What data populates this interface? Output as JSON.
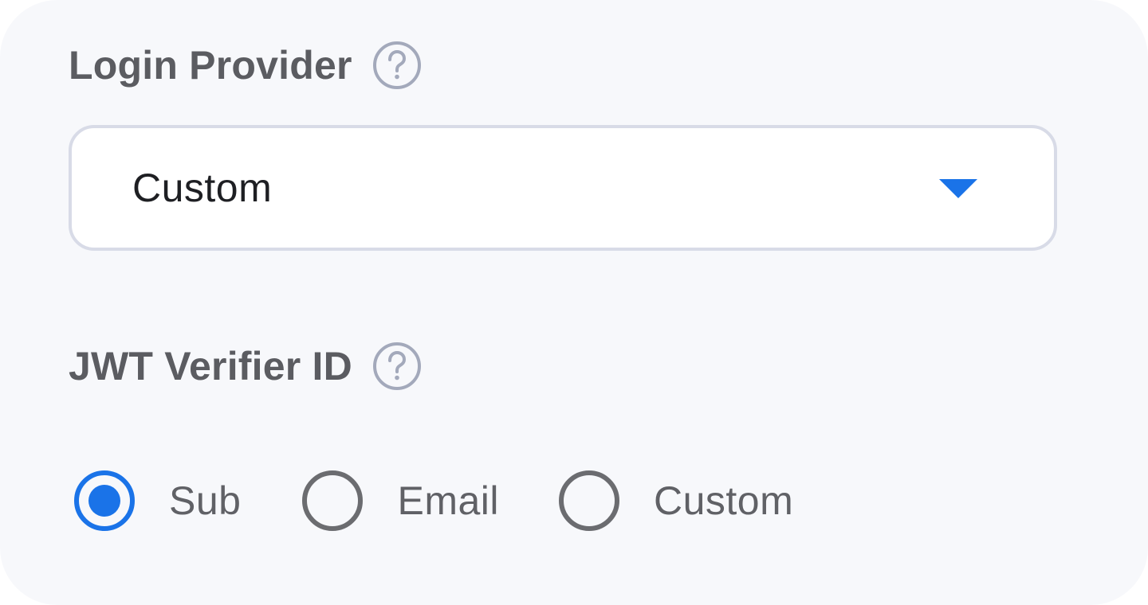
{
  "login_provider": {
    "label": "Login Provider",
    "help_icon": "question-circle-icon",
    "select": {
      "value": "Custom",
      "arrow_icon": "caret-down-icon"
    }
  },
  "jwt_verifier": {
    "label": "JWT Verifier ID",
    "help_icon": "question-circle-icon",
    "options": [
      {
        "label": "Sub",
        "selected": true
      },
      {
        "label": "Email",
        "selected": false
      },
      {
        "label": "Custom",
        "selected": false
      }
    ]
  },
  "colors": {
    "accent": "#1a73e8",
    "label_text": "#5b5c61",
    "background": "#f7f8fb",
    "border": "#d8dbe7",
    "radio_unselected": "#6b6c70",
    "help_icon": "#a3a9bb"
  }
}
